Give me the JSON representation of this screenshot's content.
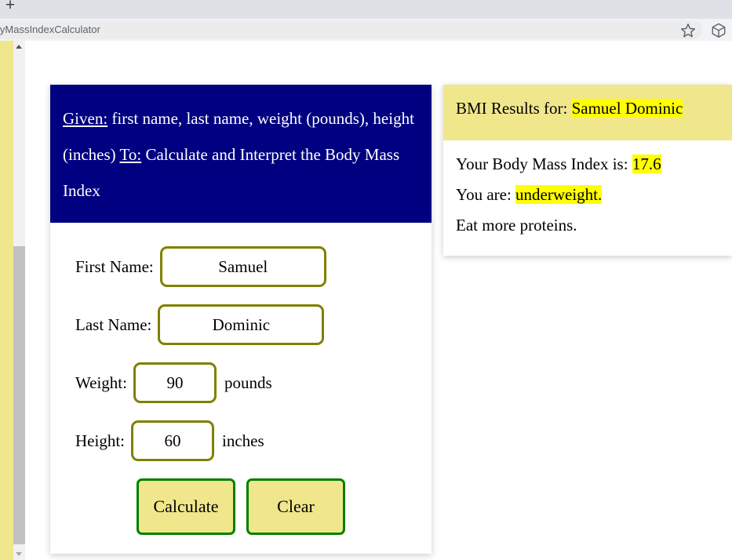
{
  "browser": {
    "new_tab_label": "+",
    "url_text": "lyMassIndexCalculator",
    "bookmark_icon": "star-icon",
    "extensions_icon": "cube-icon"
  },
  "intro": {
    "given_lead": "Given:",
    "given_text": " first name, last name, weight (pounds), height (inches)",
    "to_lead": "To:",
    "to_text": " Calculate and Interpret the Body Mass Index"
  },
  "form": {
    "fields": [
      {
        "label": "First Name:",
        "value": "Samuel",
        "unit": "",
        "size": "wide",
        "name": "first-name"
      },
      {
        "label": "Last Name:",
        "value": "Dominic",
        "unit": "",
        "size": "wide",
        "name": "last-name"
      },
      {
        "label": "Weight:",
        "value": "90",
        "unit": "pounds",
        "size": "narrow",
        "name": "weight"
      },
      {
        "label": "Height:",
        "value": "60",
        "unit": "inches",
        "size": "narrow",
        "name": "height"
      }
    ],
    "calculate_label": "Calculate",
    "clear_label": "Clear"
  },
  "results": {
    "header_prefix": "BMI Results for:",
    "header_name": "Samuel Dominic",
    "bmi_label": "Your Body Mass Index is:",
    "bmi_value": "17.6",
    "status_label": "You are:",
    "status_value": "underweight.",
    "advice": "Eat more proteins."
  },
  "colors": {
    "banner_blue": "#000080",
    "khaki": "#f0e68c",
    "highlight_yellow": "#ffff00",
    "input_border_olive": "#808000",
    "button_border_green": "#008000"
  }
}
